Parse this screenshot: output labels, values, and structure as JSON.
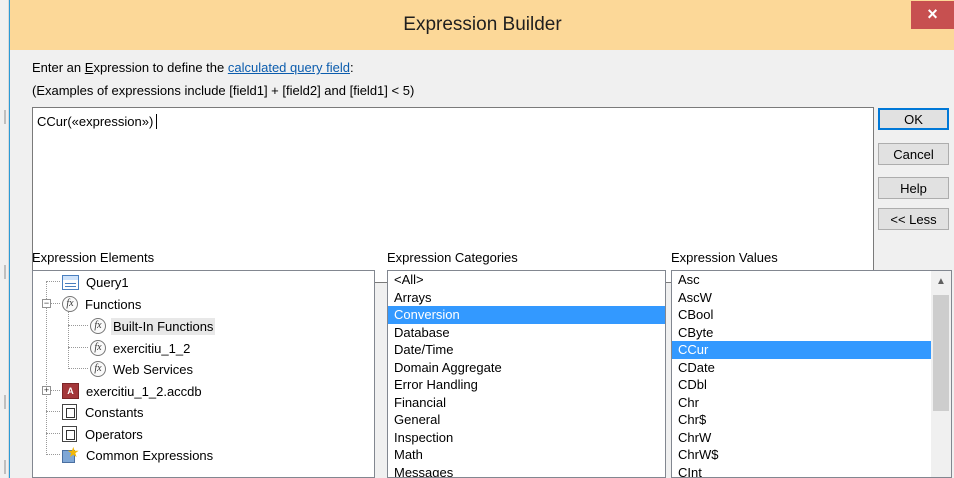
{
  "dialog": {
    "title": "Expression Builder",
    "close_label": "×"
  },
  "intro": {
    "prefix": "Enter an ",
    "accel": "E",
    "middle": "xpression to define the ",
    "link": "calculated query field",
    "suffix": ":",
    "examples": "(Examples of expressions include [field1] + [field2] and [field1] < 5)"
  },
  "expression": {
    "value": "CCur(«expression»)"
  },
  "buttons": {
    "ok": "OK",
    "cancel": "Cancel",
    "help": "Help",
    "less": "<< Less"
  },
  "elements": {
    "label": "Expression Elements",
    "items": {
      "query1": "Query1",
      "functions": "Functions",
      "builtin": "Built-In Functions",
      "exercitiu": "exercitiu_1_2",
      "webservices": "Web Services",
      "accdb": "exercitiu_1_2.accdb",
      "constants": "Constants",
      "operators": "Operators",
      "common": "Common Expressions"
    },
    "selected": "Built-In Functions"
  },
  "categories": {
    "label": "Expression Categories",
    "items": [
      "<All>",
      "Arrays",
      "Conversion",
      "Database",
      "Date/Time",
      "Domain Aggregate",
      "Error Handling",
      "Financial",
      "General",
      "Inspection",
      "Math",
      "Messages"
    ],
    "selected": "Conversion"
  },
  "values": {
    "label": "Expression Values",
    "items": [
      "Asc",
      "AscW",
      "CBool",
      "CByte",
      "CCur",
      "CDate",
      "CDbl",
      "Chr",
      "Chr$",
      "ChrW",
      "ChrW$",
      "CInt"
    ],
    "selected": "CCur"
  },
  "icons": {
    "fx": "function-icon",
    "query": "query-icon",
    "db": "database-icon",
    "grid": "constants-icon",
    "star": "common-expressions-icon",
    "scroll_up": "▲"
  },
  "colors": {
    "title_bar": "#fcd898",
    "close_button": "#c75050",
    "selection": "#3399ff",
    "link": "#0b5cad"
  }
}
